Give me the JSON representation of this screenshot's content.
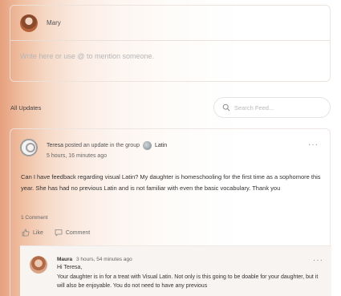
{
  "composer": {
    "user_name": "Mary",
    "placeholder": "Write here or use @ to mention someone."
  },
  "feed": {
    "title": "All Updates",
    "search_placeholder": "Search Feed..."
  },
  "post": {
    "author": "Teresa",
    "action_text": "posted an update in the group",
    "group_name": "Latin",
    "time": "5 hours, 16 minutes ago",
    "body": "Can I have feedback regarding visual Latin? My daughter is homeschooling for the first time as a sophomore this year. She has had no previous Latin and is not familiar with even the basic vocabulary. Thank you",
    "comment_count": "1 Comment",
    "like_label": "Like",
    "comment_label": "Comment",
    "more_glyph": "···"
  },
  "reply": {
    "author": "Maura",
    "time": "3 hours, 54 minutes ago",
    "greeting": "Hi Teresa,",
    "text": "Your daughter is in for a treat with Visual Latin.  Not only is this going to be doable for your daughter, but it will also be enjoyable.  You do not need to have any previous",
    "more_glyph": "···"
  }
}
